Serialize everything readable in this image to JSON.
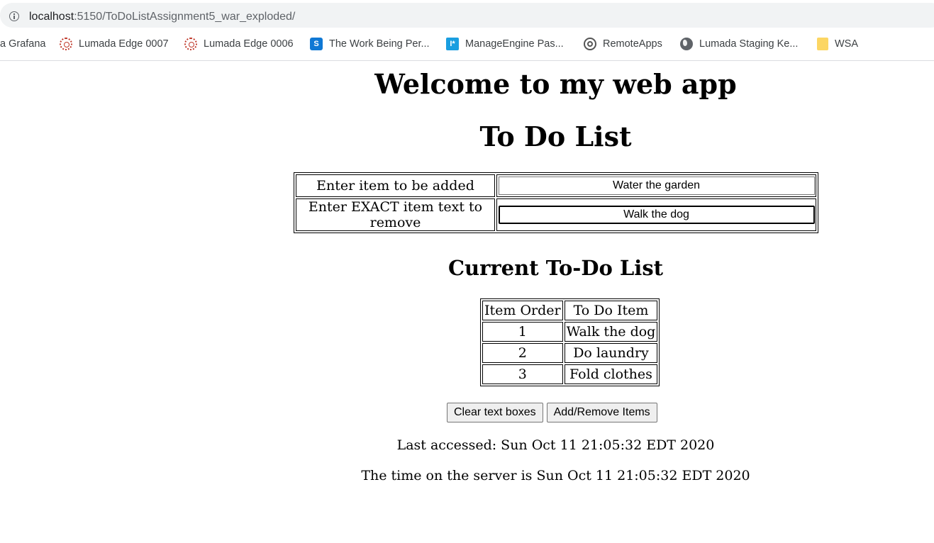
{
  "browser": {
    "url_host": "localhost",
    "url_rest": ":5150/ToDoListAssignment5_war_exploded/",
    "bookmarks": [
      {
        "label": "a Grafana",
        "icon": "none"
      },
      {
        "label": "Lumada Edge 0007",
        "icon": "gear-icon"
      },
      {
        "label": "Lumada Edge 0006",
        "icon": "gear-icon"
      },
      {
        "label": "The Work Being Per...",
        "icon": "sharepoint-icon"
      },
      {
        "label": "ManageEngine Pas...",
        "icon": "manageengine-icon"
      },
      {
        "label": "RemoteApps",
        "icon": "swirl-icon"
      },
      {
        "label": "Lumada Staging Ke...",
        "icon": "globe-icon"
      },
      {
        "label": "WSA",
        "icon": "folder-icon"
      }
    ]
  },
  "page": {
    "welcome": "Welcome to my web app",
    "title": "To Do List",
    "form": {
      "add_label": "Enter item to be added",
      "add_value": "Water the garden",
      "remove_label": "Enter EXACT item text to remove",
      "remove_value": "Walk the dog"
    },
    "list_heading": "Current To-Do List",
    "list": {
      "headers": [
        "Item Order",
        "To Do Item"
      ],
      "rows": [
        [
          "1",
          "Walk the dog"
        ],
        [
          "2",
          "Do laundry"
        ],
        [
          "3",
          "Fold clothes"
        ]
      ]
    },
    "buttons": {
      "clear": "Clear text boxes",
      "submit": "Add/Remove Items"
    },
    "last_accessed": "Last accessed: Sun Oct 11 21:05:32 EDT 2020",
    "server_time": "The time on the server is Sun Oct 11 21:05:32 EDT 2020"
  }
}
